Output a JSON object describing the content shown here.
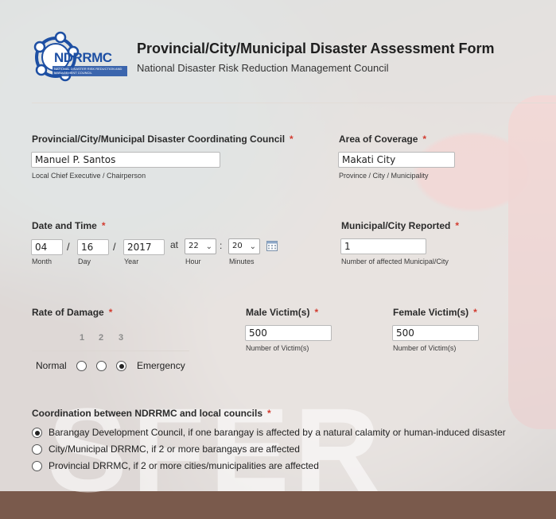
{
  "header": {
    "logo_text": "NDRRMC",
    "logo_subtext": "NATIONAL DISASTER RISK REDUCTION AND MANAGEMENT COUNCIL",
    "title": "Provincial/City/Municipal Disaster Assessment Form",
    "subtitle": "National Disaster Risk Reduction Management Council"
  },
  "coordinating_council": {
    "label": "Provincial/City/Municipal Disaster Coordinating Council",
    "required": "*",
    "value": "Manuel P. Santos",
    "sublabel": "Local Chief Executive / Chairperson"
  },
  "coverage": {
    "label": "Area of Coverage",
    "required": "*",
    "value": "Makati City",
    "sublabel": "Province / City / Municipality"
  },
  "date_time": {
    "label": "Date and Time",
    "required": "*",
    "month": "04",
    "day": "16",
    "year": "2017",
    "sep": "/",
    "at": "at",
    "colon": ":",
    "hour": "22",
    "minutes": "20",
    "month_label": "Month",
    "day_label": "Day",
    "year_label": "Year",
    "hour_label": "Hour",
    "minutes_label": "Minutes",
    "calendar_icon": "calendar-icon"
  },
  "reported": {
    "label": "Municipal/City Reported",
    "required": "*",
    "value": "1",
    "sublabel": "Number of affected Municipal/City"
  },
  "damage": {
    "label": "Rate of Damage",
    "required": "*",
    "scale": [
      "1",
      "2",
      "3"
    ],
    "low": "Normal",
    "high": "Emergency",
    "selected_index": 2
  },
  "male": {
    "label": "Male Victim(s)",
    "required": "*",
    "value": "500",
    "sublabel": "Number of Victim(s)"
  },
  "female": {
    "label": "Female Victim(s)",
    "required": "*",
    "value": "500",
    "sublabel": "Number of Victim(s)"
  },
  "coordination": {
    "label": "Coordination between NDRRMC and local councils",
    "required": "*",
    "options": [
      "Barangay Development Council, if one barangay is affected by a natural calamity or human-induced disaster",
      "City/Municipal DRRMC, if 2 or more barangays are affected",
      "Provincial DRRMC, if 2 or more cities/municipalities are affected"
    ],
    "selected_index": 0
  },
  "background_text": "SFER",
  "colors": {
    "required": "#d23b2f",
    "logo_blue": "#1d4fa3"
  }
}
